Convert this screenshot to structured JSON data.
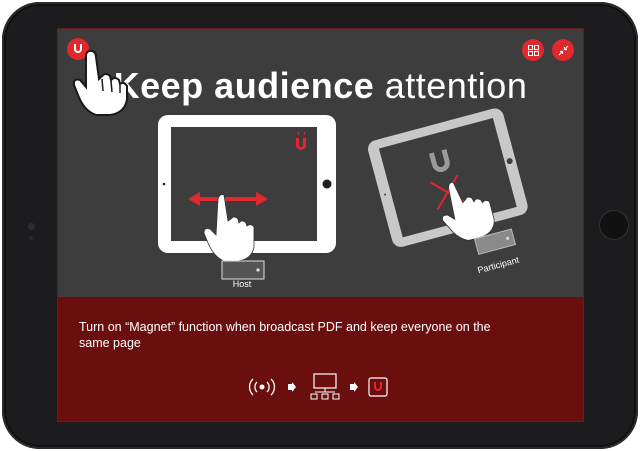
{
  "headline": {
    "bold": "Keep audience",
    "normal": " attention"
  },
  "captions": {
    "host": "Host",
    "participant": "Participant"
  },
  "description": "Turn on “Magnet” function when broadcast PDF and keep everyone on the same page",
  "buttons": {
    "magnet": "magnet-icon",
    "grid": "grid-icon",
    "collapse": "collapse-icon"
  },
  "flow": [
    "broadcast-icon",
    "arrow-right-icon",
    "network-icon",
    "arrow-right-icon",
    "magnet-icon"
  ],
  "colors": {
    "accent": "#e0282d",
    "panel": "#3d3d3d",
    "bottom": "#6b0e0e"
  }
}
